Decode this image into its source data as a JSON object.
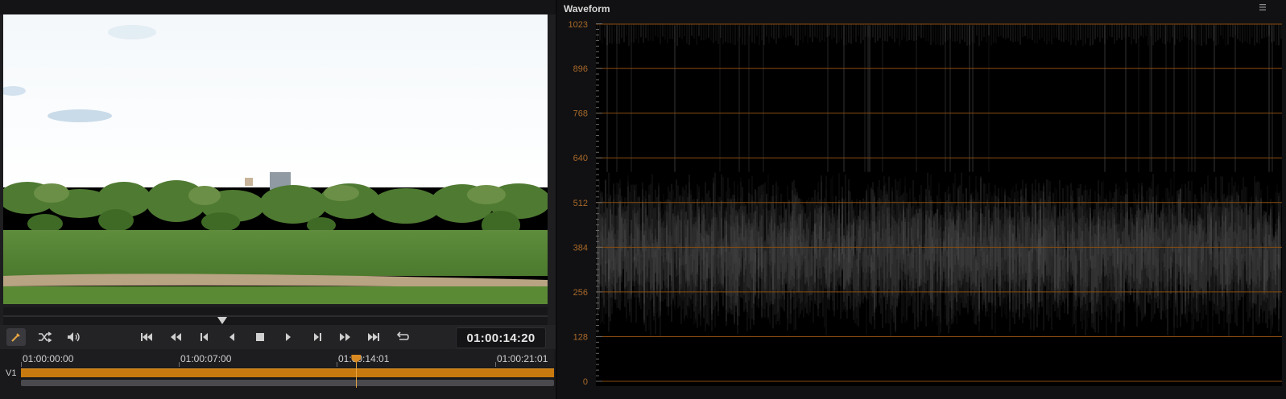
{
  "viewer": {
    "scene": "park-landscape-frame"
  },
  "transport": {
    "timecode": "01:00:14:20",
    "buttons": [
      "eyedropper-icon",
      "shuffle-icon",
      "speaker-icon",
      "jump-to-start-icon",
      "rewind-icon",
      "previous-frame-icon",
      "play-reverse-icon",
      "stop-icon",
      "play-icon",
      "next-frame-icon",
      "fast-forward-icon",
      "jump-to-end-icon",
      "loop-icon"
    ]
  },
  "timeline": {
    "track": "V1",
    "ruler": [
      "01:00:00:00",
      "01:00:07:00",
      "01:00:14:01",
      "01:00:21:01"
    ],
    "playhead_fraction": 0.629
  },
  "scope": {
    "title": "Waveform",
    "levels": [
      "1023",
      "896",
      "768",
      "640",
      "512",
      "384",
      "256",
      "128",
      "0"
    ],
    "colors": {
      "grid": "#8a4d10",
      "label": "#a8692a",
      "trace": "#ffffff"
    }
  }
}
